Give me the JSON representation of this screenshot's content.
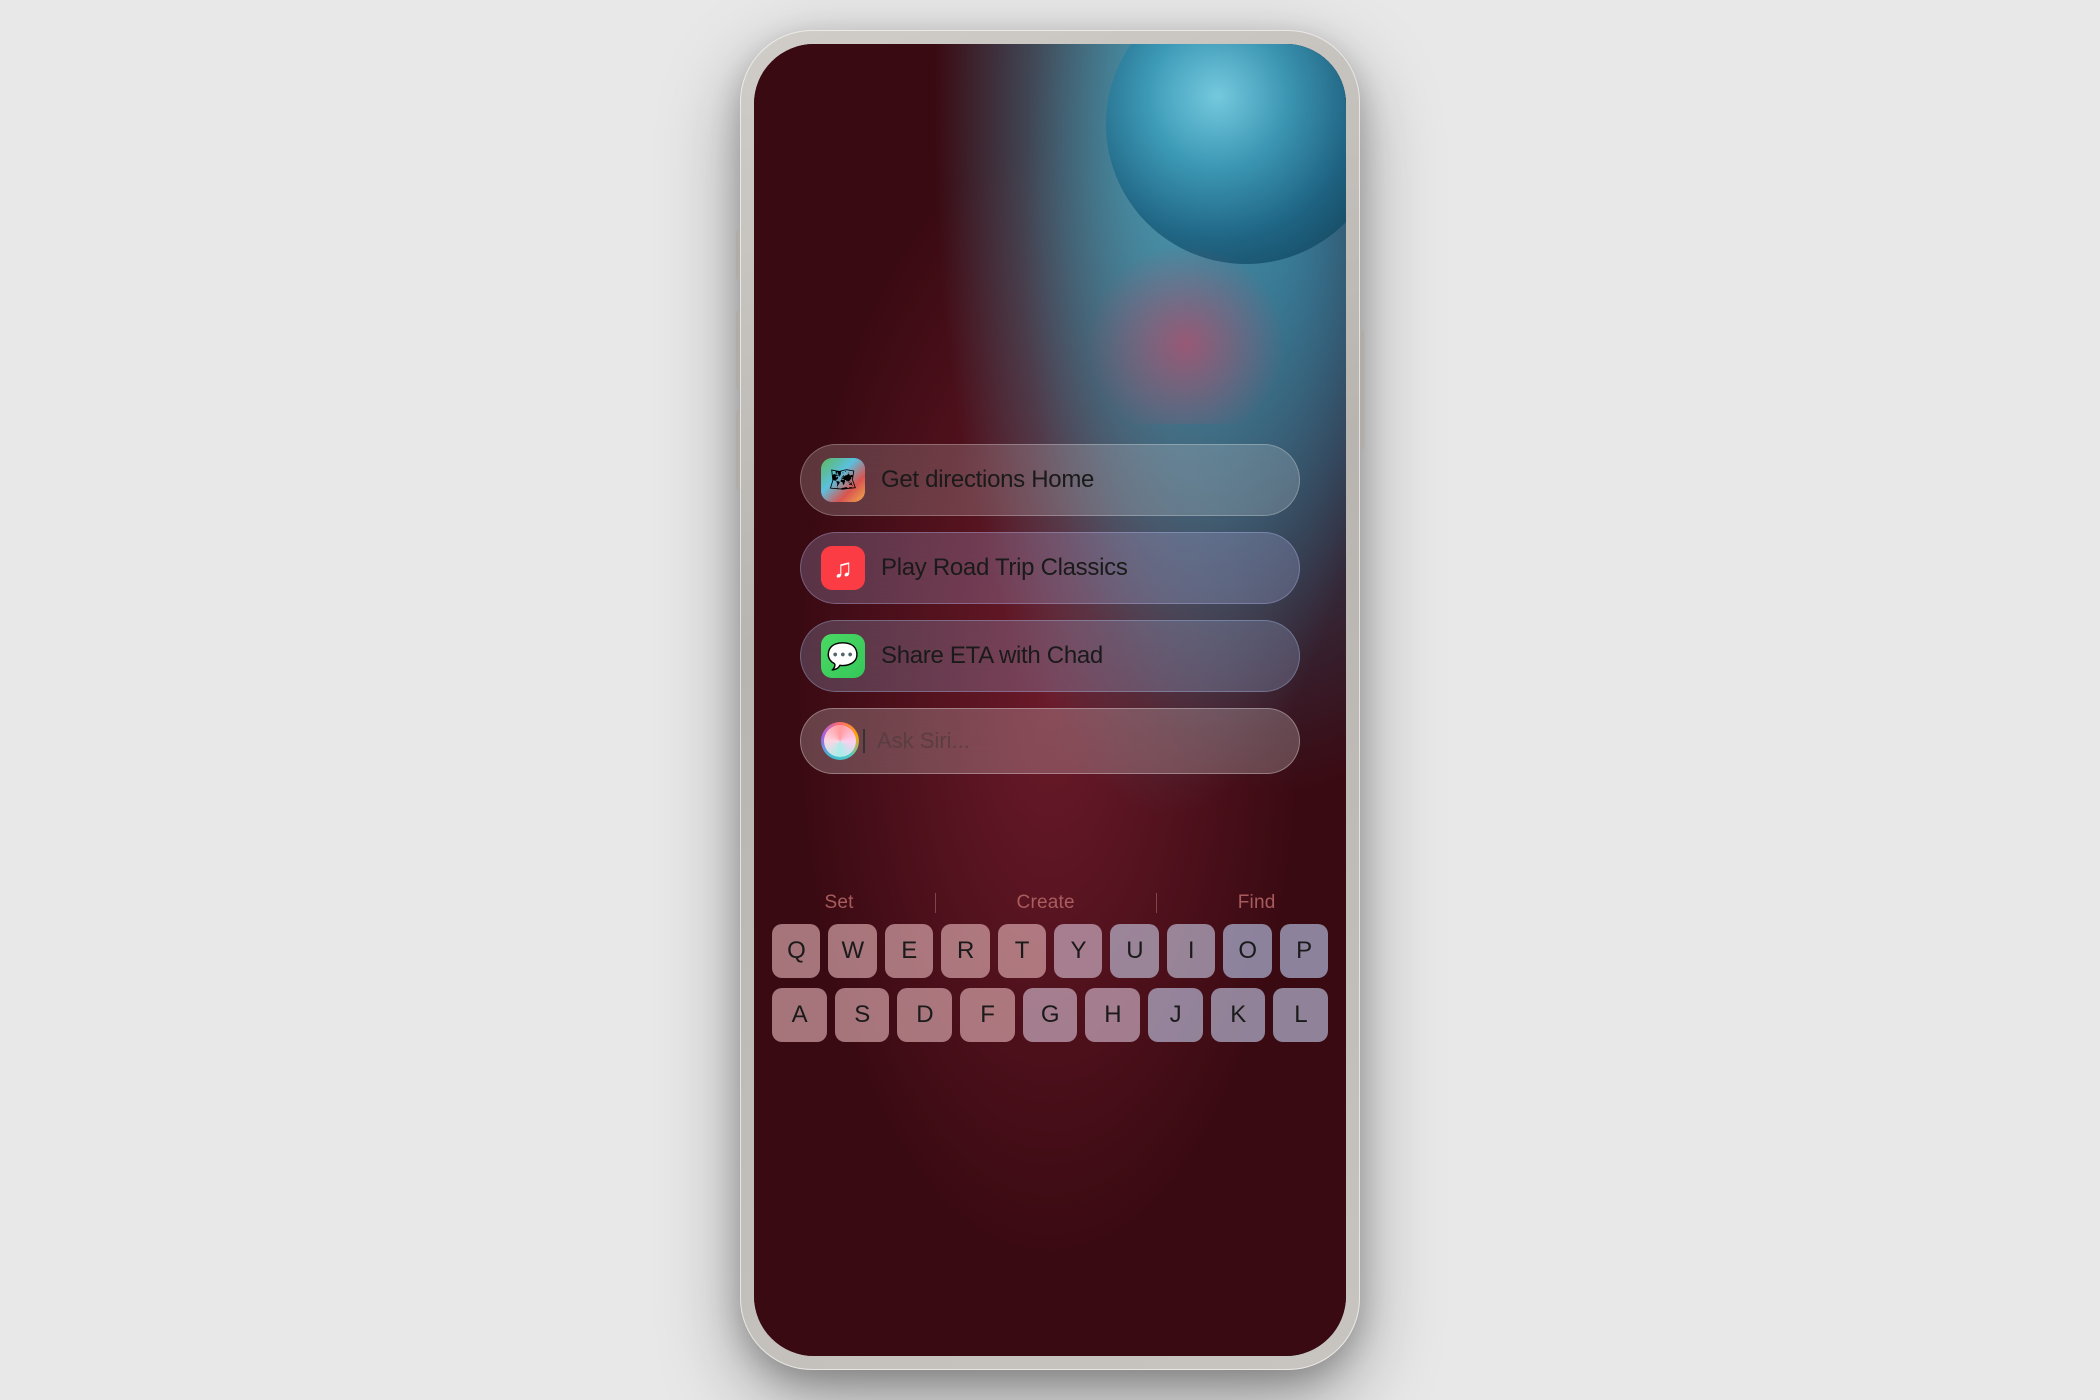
{
  "phone": {
    "suggestions": [
      {
        "id": "directions",
        "text": "Get directions Home",
        "app": "Maps",
        "icon_type": "maps"
      },
      {
        "id": "music",
        "text": "Play Road Trip Classics",
        "app": "Music",
        "icon_type": "music"
      },
      {
        "id": "messages",
        "text": "Share ETA with Chad",
        "app": "Messages",
        "icon_type": "messages"
      }
    ],
    "siri": {
      "placeholder": "Ask Siri..."
    },
    "quick_actions": [
      {
        "label": "Set"
      },
      {
        "label": "Create"
      },
      {
        "label": "Find"
      }
    ],
    "keyboard": {
      "row1": [
        "Q",
        "W",
        "E",
        "R",
        "T",
        "Y",
        "U",
        "I",
        "O",
        "P"
      ],
      "row2": [
        "A",
        "S",
        "D",
        "F",
        "G",
        "H",
        "J",
        "K",
        "L"
      ]
    }
  }
}
